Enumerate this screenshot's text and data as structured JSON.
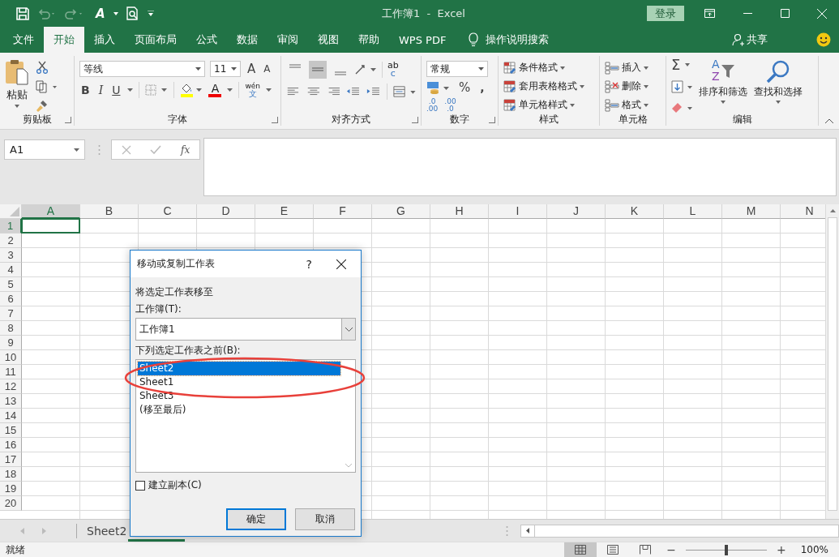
{
  "title_bar": {
    "qat_font_glyph": "A",
    "title": "工作簿1  -  Excel",
    "sign_in": "登录"
  },
  "menu_tabs": [
    {
      "label": "文件",
      "selected": false
    },
    {
      "label": "开始",
      "selected": true
    },
    {
      "label": "插入",
      "selected": false
    },
    {
      "label": "页面布局",
      "selected": false
    },
    {
      "label": "公式",
      "selected": false
    },
    {
      "label": "数据",
      "selected": false
    },
    {
      "label": "审阅",
      "selected": false
    },
    {
      "label": "视图",
      "selected": false
    },
    {
      "label": "帮助",
      "selected": false
    },
    {
      "label": "WPS PDF",
      "selected": false
    }
  ],
  "tell_me": "操作说明搜索",
  "share": "共享",
  "ribbon": {
    "clipboard": {
      "label": "剪贴板",
      "paste": "粘贴"
    },
    "font": {
      "label": "字体",
      "font_name": "等线",
      "font_size": "11",
      "grow": "A",
      "shrink": "A",
      "bold": "B",
      "italic": "I",
      "underline": "U",
      "font_color": "A",
      "phonetic_top": "wén",
      "phonetic_bottom": "文"
    },
    "alignment": {
      "label": "对齐方式",
      "wrap_top": "ab",
      "wrap_bottom": "c"
    },
    "number": {
      "label": "数字",
      "format": "常规",
      "percent": "%",
      "comma": ",",
      "increase_decimal": [
        ".0",
        ".00"
      ],
      "decrease_decimal": [
        ".00",
        ".0"
      ]
    },
    "styles": {
      "label": "样式",
      "items": [
        "条件格式",
        "套用表格格式",
        "单元格样式"
      ]
    },
    "cells": {
      "label": "单元格",
      "items": [
        "插入",
        "删除",
        "格式"
      ]
    },
    "editing": {
      "label": "编辑",
      "sum": "Σ",
      "sort_glyphs": [
        "A",
        "Z"
      ],
      "sort": "排序和筛选",
      "find": "查找和选择"
    }
  },
  "formula_bar": {
    "name_box": "A1",
    "fx": "fx"
  },
  "columns": [
    {
      "label": "A",
      "selected": true
    },
    {
      "label": "B",
      "selected": false
    },
    {
      "label": "C",
      "selected": false
    },
    {
      "label": "D",
      "selected": false
    },
    {
      "label": "E",
      "selected": false
    },
    {
      "label": "F",
      "selected": false
    },
    {
      "label": "G",
      "selected": false
    },
    {
      "label": "H",
      "selected": false
    },
    {
      "label": "I",
      "selected": false
    },
    {
      "label": "J",
      "selected": false
    },
    {
      "label": "K",
      "selected": false
    },
    {
      "label": "L",
      "selected": false
    },
    {
      "label": "M",
      "selected": false
    },
    {
      "label": "N",
      "selected": false
    }
  ],
  "rows": [
    {
      "label": "1",
      "selected": true
    },
    {
      "label": "2",
      "selected": false
    },
    {
      "label": "3",
      "selected": false
    },
    {
      "label": "4",
      "selected": false
    },
    {
      "label": "5",
      "selected": false
    },
    {
      "label": "6",
      "selected": false
    },
    {
      "label": "7",
      "selected": false
    },
    {
      "label": "8",
      "selected": false
    },
    {
      "label": "9",
      "selected": false
    },
    {
      "label": "10",
      "selected": false
    },
    {
      "label": "11",
      "selected": false
    },
    {
      "label": "12",
      "selected": false
    },
    {
      "label": "13",
      "selected": false
    },
    {
      "label": "14",
      "selected": false
    },
    {
      "label": "15",
      "selected": false
    },
    {
      "label": "16",
      "selected": false
    },
    {
      "label": "17",
      "selected": false
    },
    {
      "label": "18",
      "selected": false
    },
    {
      "label": "19",
      "selected": false
    },
    {
      "label": "20",
      "selected": false
    }
  ],
  "sheet_tabs": [
    {
      "label": "Sheet2",
      "selected": false
    }
  ],
  "status_bar": {
    "status": "就绪",
    "views": [
      {
        "kind": "normal",
        "selected": true
      },
      {
        "kind": "layout",
        "selected": false
      },
      {
        "kind": "pagebreak",
        "selected": false
      }
    ],
    "zoom_out": "−",
    "zoom_in": "+",
    "zoom": {
      "level": 0.5
    },
    "zoom_value": "100%"
  },
  "dialog": {
    "title": "移动或复制工作表",
    "help": "?",
    "section": "将选定工作表移至",
    "workbook_label": "工作簿(T):",
    "workbook_value": "工作簿1",
    "before_label": "下列选定工作表之前(B):",
    "sheets": [
      {
        "label": "Sheet2",
        "selected": true
      },
      {
        "label": "Sheet1",
        "selected": false
      },
      {
        "label": "Sheet3",
        "selected": false
      },
      {
        "label": "(移至最后)",
        "selected": false
      }
    ],
    "copy": {
      "label": "建立副本(C)",
      "checked": false
    },
    "buttons": [
      {
        "label": "确定",
        "default": true
      },
      {
        "label": "取消",
        "default": false
      }
    ]
  }
}
